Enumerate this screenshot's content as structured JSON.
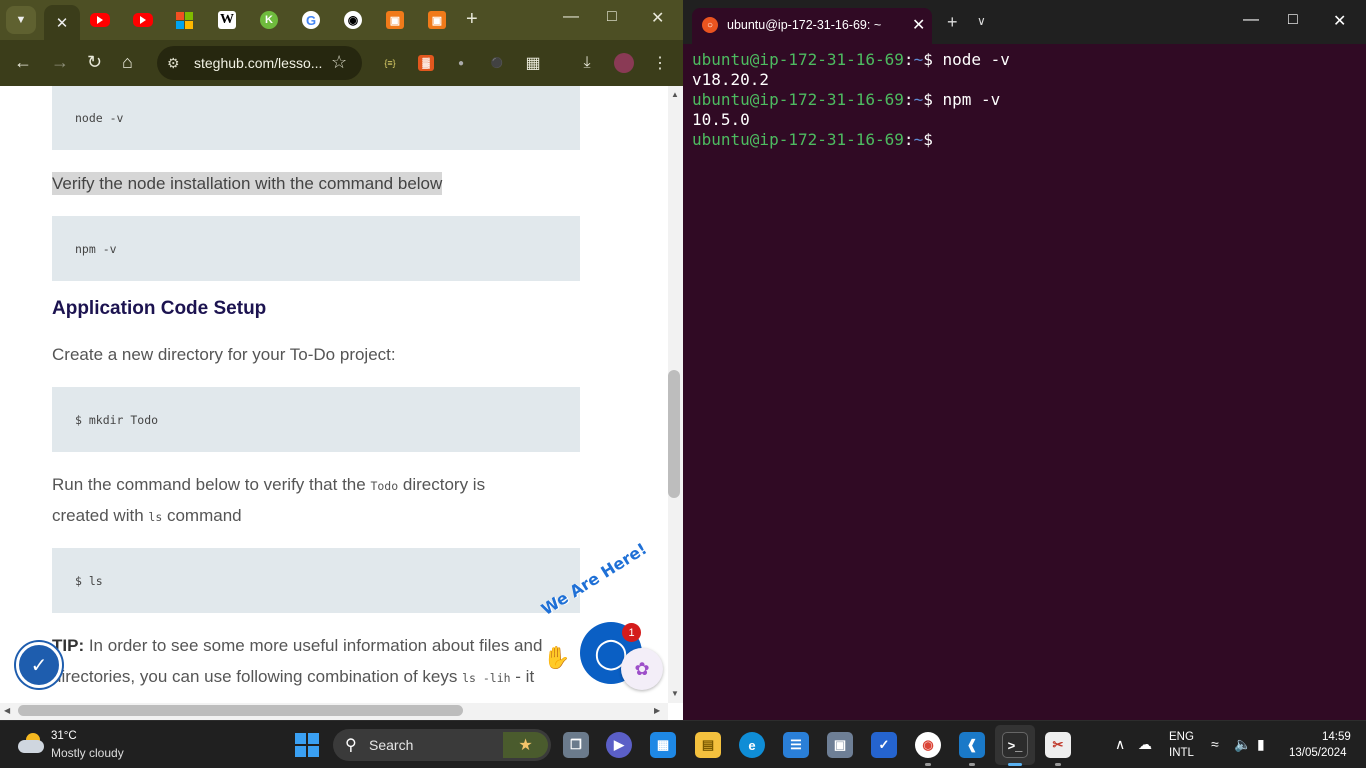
{
  "browser": {
    "tab_new_label": "+",
    "toolbar": {
      "url": "steghub.com/lesso..."
    },
    "content": {
      "code1": "node -v",
      "para_verify": "Verify the node installation with the command below",
      "code2": "npm -v",
      "heading_setup": "Application Code Setup",
      "para_create": "Create a new directory for your To-Do project:",
      "code3": "$ mkdir Todo",
      "para_run_a": "Run the command below to verify that the ",
      "para_run_code1": "Todo",
      "para_run_b": " directory is",
      "para_run_c": "created with ",
      "para_run_code2": "ls",
      "para_run_d": " command",
      "code4": "$ ls",
      "tip_label": "TIP:",
      "tip_a": " In order to see some more useful information about files and",
      "tip_b": "directories, you can use following combination of keys ",
      "tip_code": "ls -lih",
      "tip_c": " - it"
    },
    "widget": {
      "we_are_here": "We Are Here!",
      "chat_badge": "1"
    }
  },
  "terminal": {
    "tab_title": "ubuntu@ip-172-31-16-69: ~",
    "prompt_user": "ubuntu@ip-172-31-16-69",
    "prompt_path": "~",
    "lines": [
      {
        "type": "cmd",
        "text": "node -v"
      },
      {
        "type": "out",
        "text": "v18.20.2"
      },
      {
        "type": "cmd",
        "text": "npm -v"
      },
      {
        "type": "out",
        "text": "10.5.0"
      },
      {
        "type": "cmd",
        "text": ""
      }
    ]
  },
  "taskbar": {
    "weather_temp": "31°C",
    "weather_desc": "Mostly cloudy",
    "search_label": "Search",
    "lang_line1": "ENG",
    "lang_line2": "INTL",
    "time": "14:59",
    "date": "13/05/2024"
  }
}
